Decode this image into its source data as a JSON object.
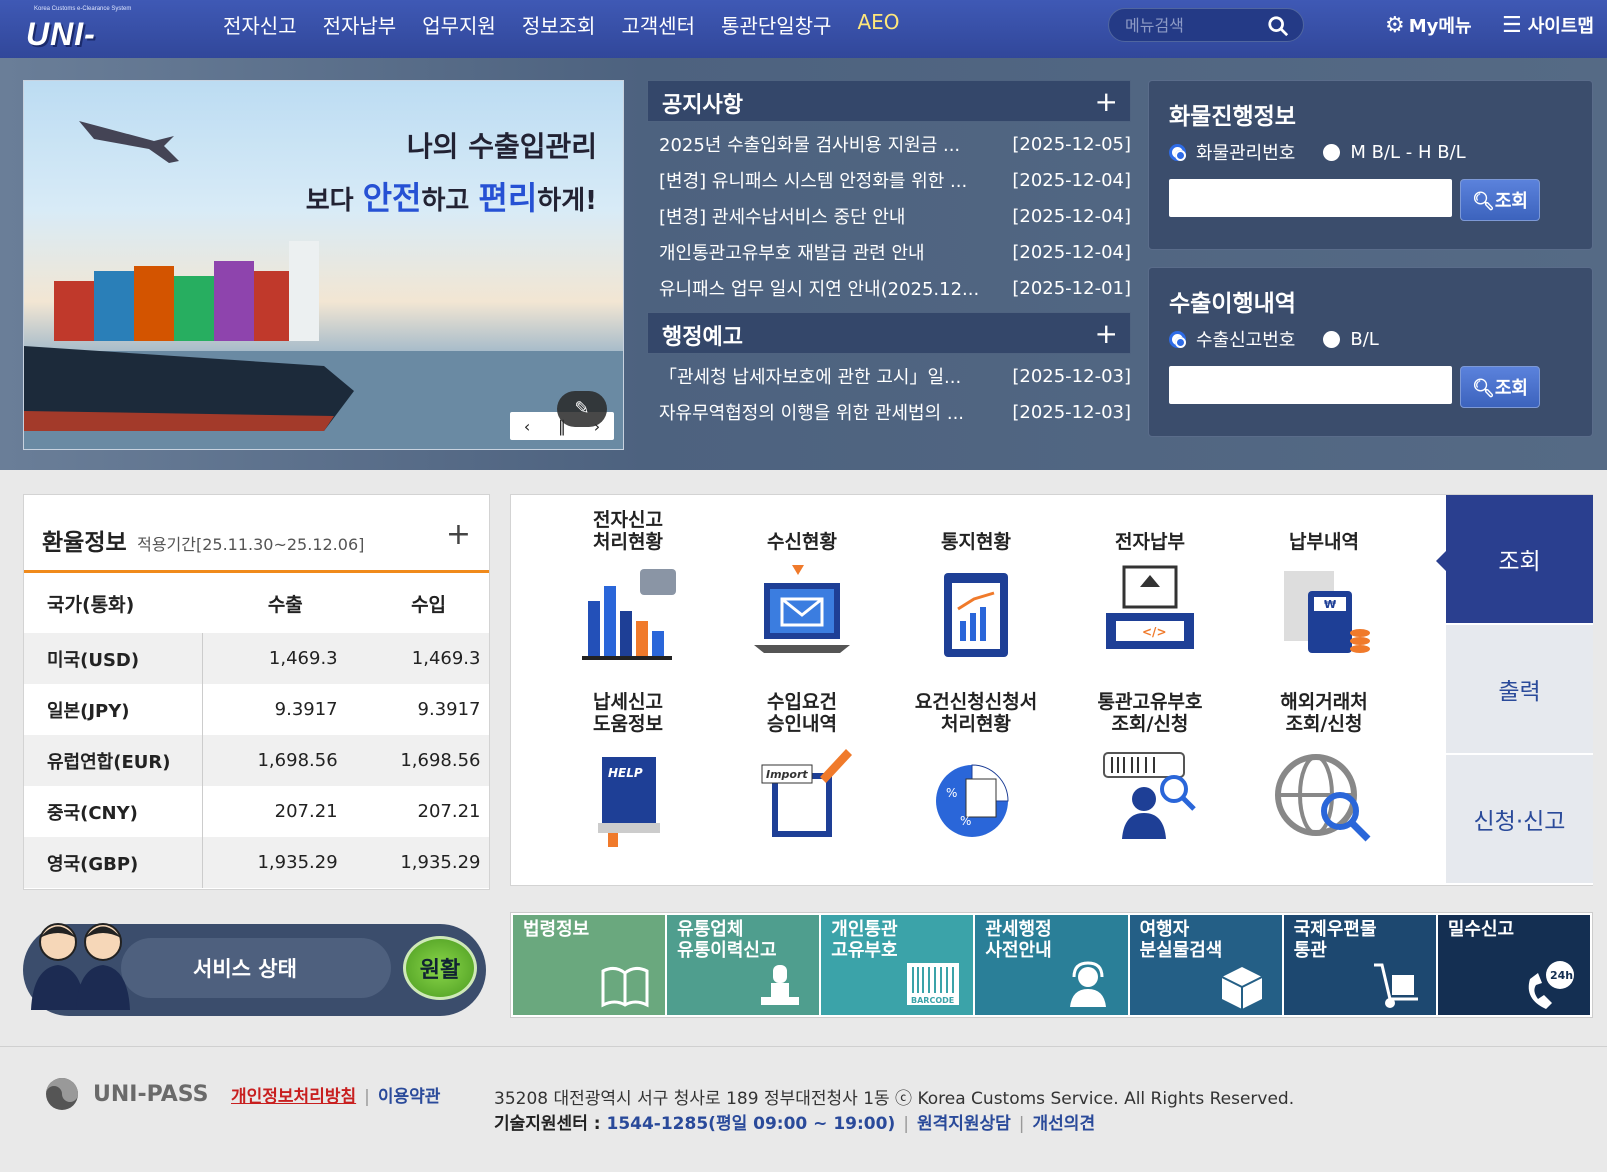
{
  "header": {
    "logo_tagline": "Korea Customs e-Clearance System",
    "logo_text": "UNI-PASS",
    "nav": [
      "전자신고",
      "전자납부",
      "업무지원",
      "정보조회",
      "고객센터",
      "통관단일창구",
      "AEO"
    ],
    "search_placeholder": "메뉴검색",
    "my_menu": "My메뉴",
    "sitemap": "사이트맵"
  },
  "banner": {
    "line1": "나의 수출입관리",
    "line2_pre": "보다 ",
    "line2_em1": "안전",
    "line2_mid": "하고 ",
    "line2_em2": "편리",
    "line2_post": "하게!",
    "prev": "‹",
    "pause": "∥",
    "next": "›"
  },
  "notices": {
    "title": "공지사항",
    "plus": "+",
    "items": [
      {
        "title": "2025년 수출입화물 검사비용 지원금 ...",
        "date": "[2025-12-05]"
      },
      {
        "title": "[변경] 유니패스 시스템 안정화를 위한 ...",
        "date": "[2025-12-04]"
      },
      {
        "title": "[변경] 관세수납서비스 중단 안내",
        "date": "[2025-12-04]"
      },
      {
        "title": "개인통관고유부호 재발급 관련 안내",
        "date": "[2025-12-04]"
      },
      {
        "title": "유니패스 업무 일시 지연 안내(2025.12...",
        "date": "[2025-12-01]"
      }
    ]
  },
  "admin_notice": {
    "title": "행정예고",
    "plus": "+",
    "items": [
      {
        "title": "「관세청 납세자보호에 관한 고시」일...",
        "date": "[2025-12-03]"
      },
      {
        "title": "자유무역협정의 이행을 위한 관세법의 ...",
        "date": "[2025-12-03]"
      }
    ]
  },
  "cargo": {
    "title": "화물진행정보",
    "option1": "화물관리번호",
    "option2": "M B/L - H B/L",
    "button": "조회"
  },
  "export_history": {
    "title": "수출이행내역",
    "option1": "수출신고번호",
    "option2": "B/L",
    "button": "조회"
  },
  "exchange": {
    "title": "환율정보",
    "period": "적용기간[25.11.30~25.12.06]",
    "plus": "+",
    "headers": {
      "country": "국가(통화)",
      "export": "수출",
      "import": "수입"
    },
    "rows": [
      {
        "country": "미국(USD)",
        "export": "1,469.3",
        "import": "1,469.3"
      },
      {
        "country": "일본(JPY)",
        "export": "9.3917",
        "import": "9.3917"
      },
      {
        "country": "유럽연합(EUR)",
        "export": "1,698.56",
        "import": "1,698.56"
      },
      {
        "country": "중국(CNY)",
        "export": "207.21",
        "import": "207.21"
      },
      {
        "country": "영국(GBP)",
        "export": "1,935.29",
        "import": "1,935.29"
      }
    ]
  },
  "services": {
    "items": [
      {
        "label": "전자신고\n처리현황",
        "icon": "bar-chart-icon"
      },
      {
        "label": "수신현황",
        "icon": "laptop-mail-icon"
      },
      {
        "label": "통지현황",
        "icon": "clipboard-chart-icon"
      },
      {
        "label": "전자납부",
        "icon": "card-terminal-icon"
      },
      {
        "label": "납부내역",
        "icon": "calculator-receipt-icon"
      },
      {
        "label": "납세신고\n도움정보",
        "icon": "help-book-icon"
      },
      {
        "label": "수입요건\n승인내역",
        "icon": "import-document-icon"
      },
      {
        "label": "요건신청신청서\n처리현황",
        "icon": "percent-pie-icon"
      },
      {
        "label": "통관고유부호\n조회/신청",
        "icon": "barcode-person-icon"
      },
      {
        "label": "해외거래처\n조회/신청",
        "icon": "globe-search-icon"
      }
    ],
    "tabs": [
      "조회",
      "출력",
      "신청·신고"
    ]
  },
  "service_status": {
    "label": "서비스 상태",
    "status": "원활"
  },
  "quick_links": [
    {
      "label": "법령정보",
      "color": "#6aa87e",
      "icon": "book-icon"
    },
    {
      "label": "유통업체\n유통이력신고",
      "color": "#4f9e8e",
      "icon": "stamp-icon"
    },
    {
      "label": "개인통관\n고유부호",
      "color": "#3ba3a9",
      "icon": "barcode-icon"
    },
    {
      "label": "관세행정\n사전안내",
      "color": "#2a7f98",
      "icon": "headset-person-icon"
    },
    {
      "label": "여행자\n분실물검색",
      "color": "#245f86",
      "icon": "box-icon"
    },
    {
      "label": "국제우편물\n통관",
      "color": "#1d4870",
      "icon": "hand-truck-icon"
    },
    {
      "label": "밀수신고",
      "color": "#142f52",
      "icon": "phone-24h-icon"
    }
  ],
  "barcode_text": "BARCODE",
  "phone_24h": "24h",
  "footer": {
    "logo": "UNI-PASS",
    "privacy": "개인정보처리방침",
    "terms": "이용약관",
    "address": "35208 대전광역시 서구 청사로 189 정부대전청사 1동 ⓒ Korea Customs Service. All Rights Reserved.",
    "support_label": "기술지원센터 :",
    "support_number": "1544-1285(평일 09:00 ~ 19:00)",
    "remote": "원격지원상담",
    "feedback": "개선의견"
  }
}
